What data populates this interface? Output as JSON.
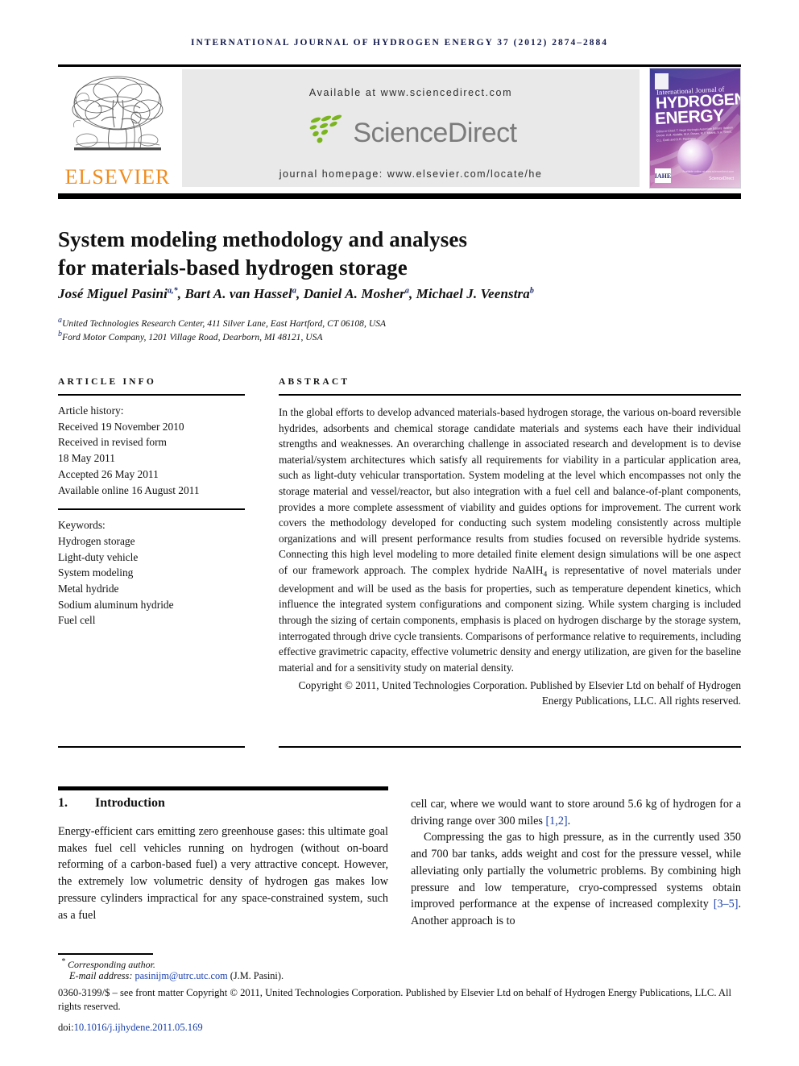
{
  "header": {
    "journal_line": "INTERNATIONAL JOURNAL OF HYDROGEN ENERGY 37 (2012) 2874–2884"
  },
  "banner": {
    "publisher_name": "ELSEVIER",
    "publisher_logo_alt": "elsevier-tree-logo",
    "available_at": "Available at www.sciencedirect.com",
    "sciencedirect_wordmark": "ScienceDirect",
    "journal_homepage": "journal homepage: www.elsevier.com/locate/he",
    "cover": {
      "line1": "International Journal of",
      "line2": "HYDROGEN",
      "line3": "ENERGY",
      "editors": "Editor-in-Chief:  T. Nejat Veziroglu\nAssociate Editors: Ibrahim Dincer, A.M. Abdalla, M.A. Rosen, M.T. Mbarki, S.A. Sherif, C.L. Gosh and D.R. Pankratov",
      "badge": "IAHE",
      "sciencedirect_note": "Available online at www.sciencedirect.com",
      "sciencedirect_label": "ScienceDirect"
    }
  },
  "article": {
    "title_line1": "System modeling methodology and analyses",
    "title_line2": "for materials-based hydrogen storage",
    "authors": [
      {
        "name": "José Miguel Pasini",
        "marks": "a,*"
      },
      {
        "name": "Bart A. van Hassel",
        "marks": "a"
      },
      {
        "name": "Daniel A. Mosher",
        "marks": "a"
      },
      {
        "name": "Michael J. Veenstra",
        "marks": "b"
      }
    ],
    "affiliation_a_mark": "a",
    "affiliation_a": "United Technologies Research Center, 411 Silver Lane, East Hartford, CT 06108, USA",
    "affiliation_b_mark": "b",
    "affiliation_b": "Ford Motor Company, 1201 Village Road, Dearborn, MI 48121, USA"
  },
  "article_info": {
    "heading": "ARTICLE INFO",
    "history_label": "Article history:",
    "history": [
      "Received 19 November 2010",
      "Received in revised form",
      "18 May 2011",
      "Accepted 26 May 2011",
      "Available online 16 August 2011"
    ],
    "keywords_label": "Keywords:",
    "keywords": [
      "Hydrogen storage",
      "Light-duty vehicle",
      "System modeling",
      "Metal hydride",
      "Sodium aluminum hydride",
      "Fuel cell"
    ]
  },
  "abstract": {
    "heading": "ABSTRACT",
    "part1": "In the global efforts to develop advanced materials-based hydrogen storage, the various on-board reversible hydrides, adsorbents and chemical storage candidate materials and systems each have their individual strengths and weaknesses. An overarching challenge in associated research and development is to devise material/system architectures which satisfy all requirements for viability in a particular application area, such as light-duty vehicular transportation. System modeling at the level which encompasses not only the storage material and vessel/reactor, but also integration with a fuel cell and balance-of-plant components, provides a more complete assessment of viability and guides options for improvement. The current work covers the methodology developed for conducting such system modeling consistently across multiple organizations and will present performance results from studies focused on reversible hydride systems. Connecting this high level modeling to more detailed finite element design simulations will be one aspect of our framework approach. The complex hydride NaAlH",
    "formula_sub": "4",
    "part2": " is representative of novel materials under development and will be used as the basis for properties, such as temperature dependent kinetics, which influence the integrated system configurations and component sizing. While system charging is included through the sizing of certain components, emphasis is placed on hydrogen discharge by the storage system, interrogated through drive cycle transients. Comparisons of performance relative to requirements, including effective gravimetric capacity, effective volumetric density and energy utilization, are given for the baseline material and for a sensitivity study on material density.",
    "copyright": "Copyright © 2011, United Technologies Corporation. Published by Elsevier Ltd on behalf of Hydrogen Energy Publications, LLC. All rights reserved."
  },
  "body": {
    "section_number": "1.",
    "section_title": "Introduction",
    "left_paragraph": "Energy-efficient cars emitting zero greenhouse gases: this ultimate goal makes fuel cell vehicles running on hydrogen (without on-board reforming of a carbon-based fuel) a very attractive concept. However, the extremely low volumetric density of hydrogen gas makes low pressure cylinders impractical for any space-constrained system, such as a fuel",
    "right_paragraph_1_pre": "cell car, where we would want to store around 5.6 kg of hydrogen for a driving range over 300 miles ",
    "right_paragraph_1_ref": "[1,2]",
    "right_paragraph_1_post": ".",
    "right_paragraph_2_pre": "Compressing the gas to high pressure, as in the currently used 350 and 700 bar tanks, adds weight and cost for the pressure vessel, while alleviating only partially the volumetric problems. By combining high pressure and low temperature, cryo-compressed systems obtain improved performance at the expense of increased complexity ",
    "right_paragraph_2_ref": "[3–5]",
    "right_paragraph_2_post": ". Another approach is to"
  },
  "footer": {
    "corresponding_marker": "*",
    "corresponding_label": "Corresponding author.",
    "email_label": "E-mail address:",
    "email": "pasinijm@utrc.utc.com",
    "email_suffix": "(J.M. Pasini).",
    "issn_line": "0360-3199/$ – see front matter Copyright © 2011, United Technologies Corporation. Published by Elsevier Ltd on behalf of Hydrogen Energy Publications, LLC. All rights reserved.",
    "doi_label": "doi:",
    "doi": "10.1016/j.ijhydene.2011.05.169"
  },
  "colors": {
    "journal_header": "#141b4d",
    "elsevier_orange": "#f08c1e",
    "sciencedirect_green": "#7ab51d",
    "sciencedirect_gray": "#7b7b7b",
    "link_blue": "#1a3faa",
    "banner_bg": "#e9e9e9"
  }
}
